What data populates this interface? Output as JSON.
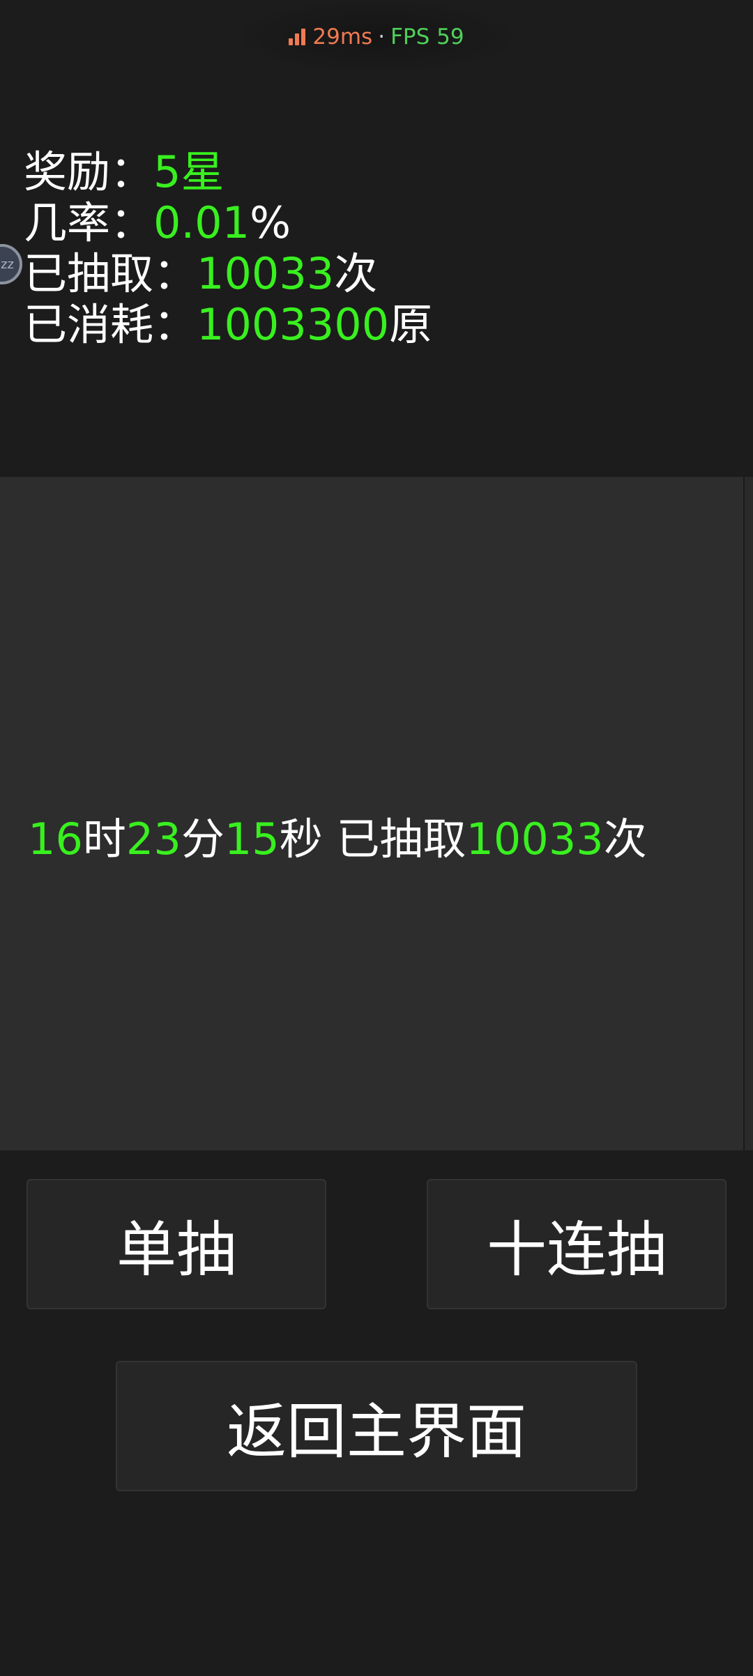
{
  "network": {
    "ms": "29ms",
    "separator": "·",
    "fps": "FPS 59"
  },
  "stats": {
    "reward_label": "奖励：",
    "reward_value": "5星",
    "rate_label": "几率：",
    "rate_value": "0.01",
    "rate_unit": "%",
    "drawn_label": "已抽取：",
    "drawn_value": "10033",
    "drawn_unit": "次",
    "spent_label": "已消耗：",
    "spent_value": "1003300",
    "spent_unit": "原"
  },
  "bubble": {
    "text": "zz"
  },
  "timer": {
    "hours": "16",
    "hours_unit": "时",
    "minutes": "23",
    "minutes_unit": "分",
    "seconds": "15",
    "seconds_unit": "秒",
    "drawn_label": " 已抽取",
    "drawn_value": "10033",
    "drawn_unit": "次"
  },
  "buttons": {
    "single": "单抽",
    "ten": "十连抽",
    "back": "返回主界面"
  },
  "colors": {
    "background": "#1c1c1c",
    "panel": "#2d2d2d",
    "highlight_green": "#39f01f",
    "latency_orange": "#f07a52",
    "fps_green": "#4fd05a"
  }
}
